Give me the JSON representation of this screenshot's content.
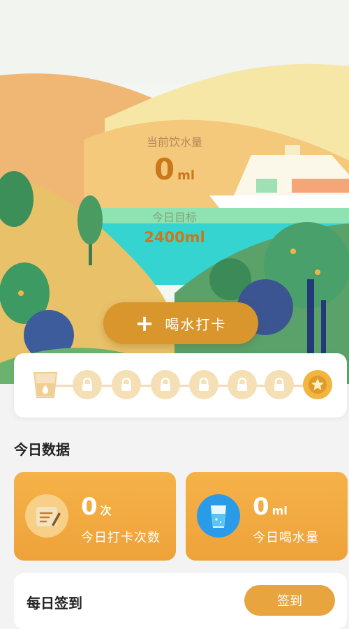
{
  "current": {
    "label": "当前饮水量",
    "value": "0",
    "unit": "ml"
  },
  "goal": {
    "label": "今日目标",
    "value": "2400ml"
  },
  "drink_button": {
    "icon": "plus-icon",
    "label": "喝水打卡"
  },
  "progress": {
    "total_steps": 8,
    "completed": 0,
    "step_icons": [
      "cup-icon",
      "lock-icon",
      "lock-icon",
      "lock-icon",
      "lock-icon",
      "lock-icon",
      "lock-icon",
      "star-icon"
    ]
  },
  "today": {
    "title": "今日数据",
    "checkins": {
      "value": "0",
      "unit": "次",
      "caption": "今日打卡次数",
      "icon": "notepad-icon"
    },
    "water": {
      "value": "0",
      "unit": "ml",
      "caption": "今日喝水量",
      "icon": "water-glass-icon"
    }
  },
  "daily_signin": {
    "title": "每日签到",
    "button": "签到"
  },
  "colors": {
    "accent": "#d9962c",
    "card_orange": "#f0a63e",
    "track": "#f0dcb7"
  }
}
